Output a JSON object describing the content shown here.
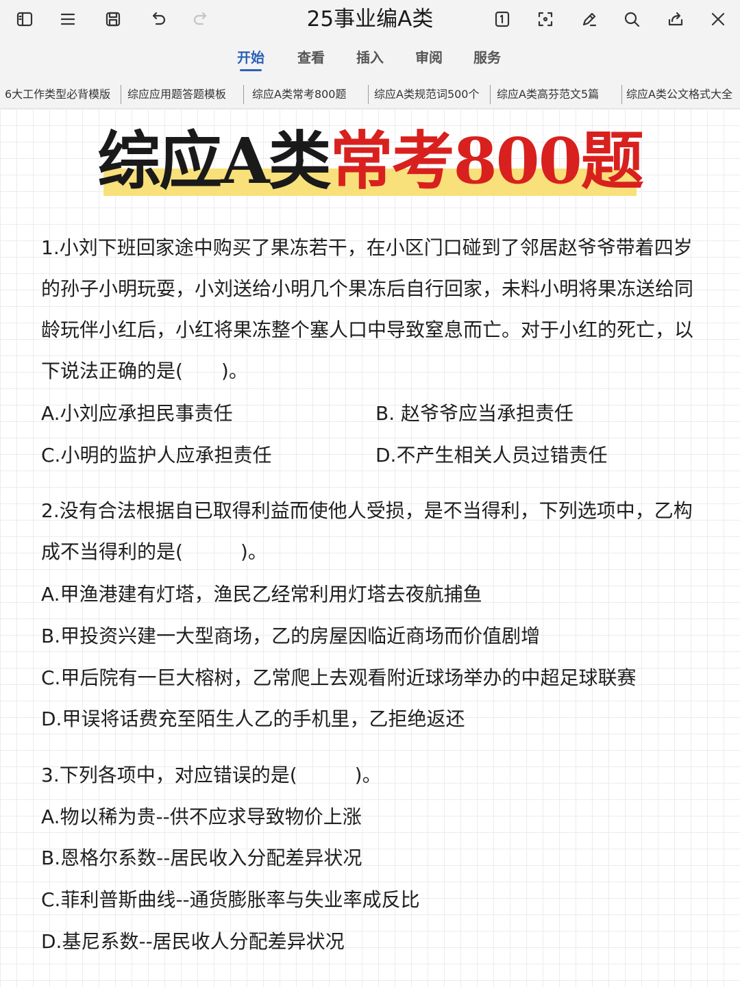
{
  "app": {
    "title": "25事业编A类",
    "menu": [
      "开始",
      "查看",
      "插入",
      "审阅",
      "服务"
    ],
    "active_menu_index": 0,
    "accent_color": "#2c5fb8",
    "toolbar_icons": [
      "sidebar-icon",
      "menu-icon",
      "save-icon",
      "undo-icon",
      "redo-icon",
      "page-number-icon",
      "fullscreen-icon",
      "edit-pen-icon",
      "search-icon",
      "share-icon",
      "close-icon"
    ]
  },
  "tabs": [
    "6大工作类型必背模版",
    "综应应用题答题模板",
    "综应A类常考800题",
    "综应A类规范词500个",
    "综应A类高芬范文5篇",
    "综应A类公文格式大全"
  ],
  "document": {
    "title_black": "综应A类",
    "title_red": "常考800题",
    "title_red_color": "#d8211e",
    "highlight_color": "#f8e07a",
    "questions": [
      {
        "stem": "1.小刘下班回家途中购买了果冻若干，在小区门口碰到了邻居赵爷爷带着四岁的孙子小明玩耍，小刘送给小明几个果冻后自行回家，未料小明将果冻送给同龄玩伴小红后，小红将果冻整个塞人口中导致窒息而亡。对于小红的死亡，以下说法正确的是(　　)。",
        "options": [
          "A.小刘应承担民事责任",
          "B. 赵爷爷应当承担责任",
          "C.小明的监护人应承担责任",
          "D.不产生相关人员过错责任"
        ]
      },
      {
        "stem": "2.没有合法根据自已取得利益而使他人受损，是不当得利，下列选项中，乙构成不当得利的是(　　　)。",
        "options": [
          "A.甲渔港建有灯塔，渔民乙经常利用灯塔去夜航捕鱼",
          "B.甲投资兴建一大型商场，乙的房屋因临近商场而价值剧增",
          "C.甲后院有一巨大榕树，乙常爬上去观看附近球场举办的中超足球联赛",
          "D.甲误将话费充至陌生人乙的手机里，乙拒绝返还"
        ]
      },
      {
        "stem": "3.下列各项中，对应错误的是(　　　)。",
        "options": [
          "A.物以稀为贵--供不应求导致物价上涨",
          "B.恩格尔系数--居民收入分配差异状况",
          "C.菲利普斯曲线--通货膨胀率与失业率成反比",
          "D.基尼系数--居民收人分配差异状况"
        ]
      }
    ]
  }
}
